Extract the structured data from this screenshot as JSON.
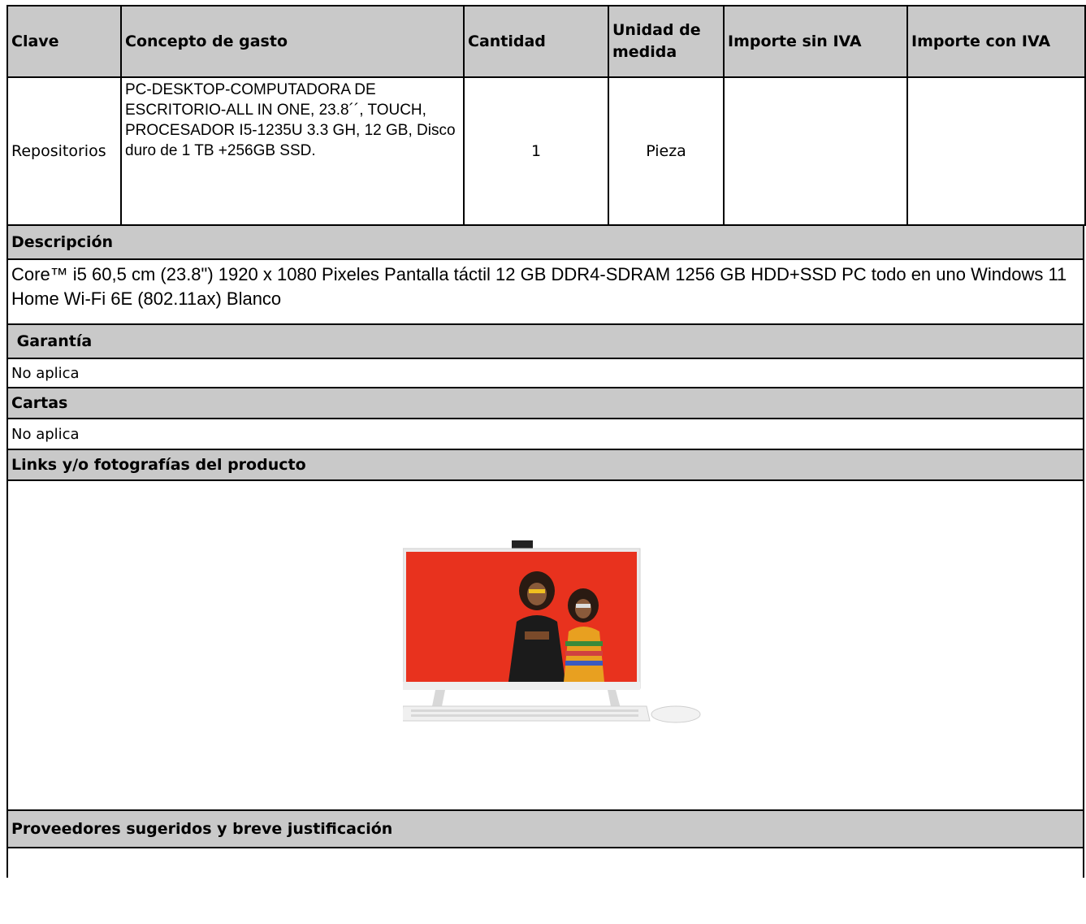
{
  "table": {
    "headers": [
      "Clave",
      "Concepto de gasto",
      "Cantidad",
      "Unidad de medida",
      "Importe sin IVA",
      "Importe con IVA"
    ],
    "row": {
      "clave": "Repositorios",
      "concepto": "PC-DESKTOP-COMPUTADORA DE ESCRITORIO-ALL IN ONE, 23.8´´, TOUCH, PROCESADOR I5-1235U 3.3 GH, 12 GB, Disco duro de 1 TB +256GB SSD.",
      "cantidad": "1",
      "unidad": "Pieza",
      "importe_sin_iva": "",
      "importe_con_iva": ""
    }
  },
  "sections": {
    "descripcion_title": "Descripción",
    "descripcion_text": "Core™ i5 60,5 cm (23.8\") 1920 x 1080 Pixeles Pantalla táctil 12 GB DDR4-SDRAM 1256 GB HDD+SSD PC todo en uno Windows 11 Home Wi-Fi 6E (802.11ax) Blanco",
    "garantia_title": " Garantía",
    "garantia_text": "No aplica",
    "cartas_title": "Cartas",
    "cartas_text": "No aplica",
    "links_title": "Links y/o fotografías del producto",
    "proveedores_title": "Proveedores sugeridos y breve justificación",
    "proveedores_text": ""
  },
  "colors": {
    "header_bg": "#c9c9c9",
    "border": "#000000",
    "screen_red": "#e8321e"
  }
}
